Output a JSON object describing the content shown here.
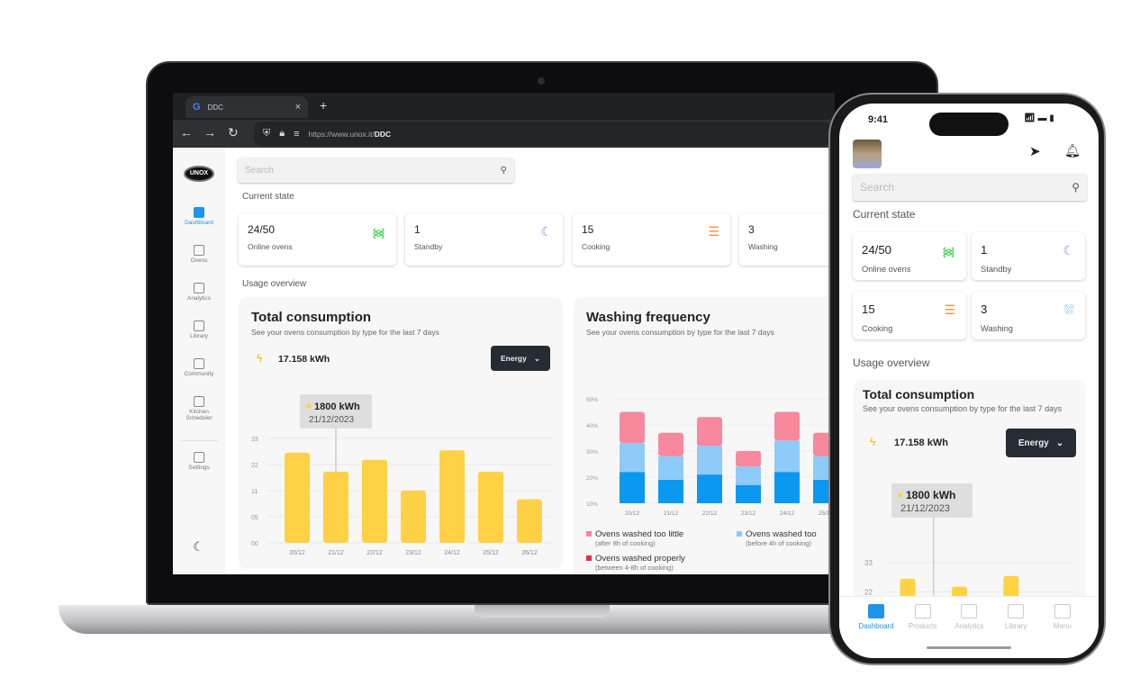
{
  "colors": {
    "accent": "#1e95e8",
    "yellow": "#FFD145",
    "pink": "#F7889E",
    "light_blue": "#8ECBF8",
    "blue": "#0A98F0",
    "red": "#E8294E",
    "dark": "#262c33"
  },
  "browser": {
    "tab_title": "DDC",
    "new_tab": "+",
    "close": "×",
    "url_prefix": "https://www.unox.it/",
    "url_path": "DDC"
  },
  "logo": "UNOX",
  "sidebar": {
    "items": [
      {
        "label": "Dashboard",
        "icon": "dashboard-icon",
        "active": true
      },
      {
        "label": "Ovens",
        "icon": "ovens-icon"
      },
      {
        "label": "Analytics",
        "icon": "analytics-icon"
      },
      {
        "label": "Library",
        "icon": "library-icon"
      },
      {
        "label": "Community",
        "icon": "community-icon"
      },
      {
        "label": "Kitchen Scheduler",
        "icon": "calendar-icon"
      },
      {
        "label": "Settings",
        "icon": "gear-icon"
      }
    ],
    "theme_icon": "moon-icon"
  },
  "search": {
    "placeholder": "Search"
  },
  "current_state": {
    "title": "Current state",
    "cards": [
      {
        "value": "24/50",
        "label": "Online ovens",
        "icon": "wifi-icon",
        "color": "#3ccf4e"
      },
      {
        "value": "1",
        "label": "Standby",
        "icon": "moon-icon",
        "color": "#9b7fe0"
      },
      {
        "value": "15",
        "label": "Cooking",
        "icon": "sliders-icon",
        "color": "#f5903b"
      },
      {
        "value": "3",
        "label": "Washing",
        "icon": "shower-icon",
        "color": "#2fa6ea"
      }
    ]
  },
  "usage": {
    "title": "Usage overview"
  },
  "total": {
    "title": "Total consumption",
    "subtitle": "See your ovens consumption by type for the last 7 days",
    "total": "17.158 kWh",
    "dropdown": "Energy",
    "tooltip_value": "1800 kWh",
    "tooltip_date": "21/12/2023"
  },
  "washing": {
    "title": "Washing frequency",
    "subtitle": "See your ovens consumption by type for the last 7 days",
    "legend": [
      {
        "label": "Ovens washed too little",
        "sub": "(after 8h of cooking)",
        "color": "#F7889E"
      },
      {
        "label": "Ovens washed too",
        "sub": "(before 4h of cooking)",
        "color": "#8ECBF8"
      },
      {
        "label": "Ovens washed properly",
        "sub": "(between 4-8h of cooking)",
        "color": "#E8294E"
      }
    ]
  },
  "chart_data": [
    {
      "type": "bar",
      "title": "Total consumption",
      "categories": [
        "20/12",
        "21/12",
        "22/12",
        "23/12",
        "24/12",
        "25/12",
        "26/12"
      ],
      "values": [
        27,
        19,
        24,
        11,
        28,
        19,
        9
      ],
      "yticks": [
        "00",
        "05",
        "11",
        "22",
        "33"
      ],
      "ytick_values": [
        0,
        5,
        11,
        22,
        33
      ],
      "highlight": "21/12",
      "grid": true
    },
    {
      "type": "bar",
      "stacked": true,
      "title": "Washing frequency",
      "categories": [
        "20/12",
        "21/12",
        "22/12",
        "23/12",
        "24/12",
        "25/12"
      ],
      "yticks": [
        "10%",
        "20%",
        "30%",
        "40%",
        "50%"
      ],
      "ylim": [
        10,
        50
      ],
      "grid": true,
      "legend": "bottom",
      "series": [
        {
          "color": "#0A98F0",
          "values": [
            22,
            19,
            21,
            17,
            22,
            19
          ]
        },
        {
          "name": "Ovens washed too",
          "color": "#8ECBF8",
          "values": [
            11,
            9,
            11,
            7,
            12,
            9
          ]
        },
        {
          "name": "Ovens washed too little",
          "color": "#F7889E",
          "values": [
            12,
            9,
            11,
            6,
            11,
            9
          ]
        }
      ]
    }
  ],
  "phone": {
    "time": "9:41",
    "nav": [
      {
        "label": "Dashboard",
        "active": true
      },
      {
        "label": "Products"
      },
      {
        "label": "Analytics"
      },
      {
        "label": "Library"
      },
      {
        "label": "Menu"
      }
    ],
    "total_subtitle": "See your ovens consumption by type for the last 7 days"
  }
}
